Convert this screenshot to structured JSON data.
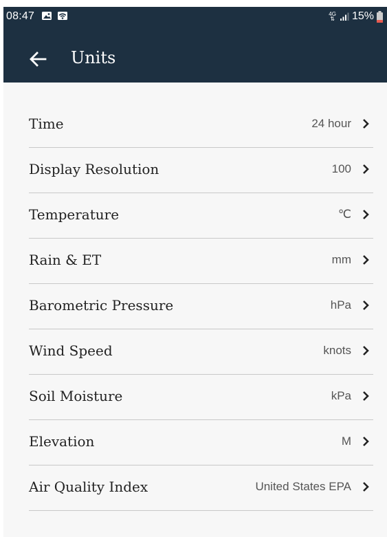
{
  "status_bar": {
    "time": "08:47",
    "network_type": "4G",
    "battery": "15%"
  },
  "header": {
    "title": "Units",
    "back_icon": "arrow-left-icon"
  },
  "settings": [
    {
      "label": "Time",
      "value": "24 hour"
    },
    {
      "label": "Display Resolution",
      "value": "100"
    },
    {
      "label": "Temperature",
      "value": "℃"
    },
    {
      "label": "Rain & ET",
      "value": "mm"
    },
    {
      "label": "Barometric Pressure",
      "value": "hPa"
    },
    {
      "label": "Wind Speed",
      "value": "knots"
    },
    {
      "label": "Soil Moisture",
      "value": "kPa"
    },
    {
      "label": "Elevation",
      "value": "M"
    },
    {
      "label": "Air Quality Index",
      "value": "United States EPA"
    }
  ],
  "colors": {
    "header_background": "#1d3041",
    "screen_background": "#f7f7f7",
    "divider": "#c8c8c8",
    "battery_low": "#e85a4f"
  }
}
